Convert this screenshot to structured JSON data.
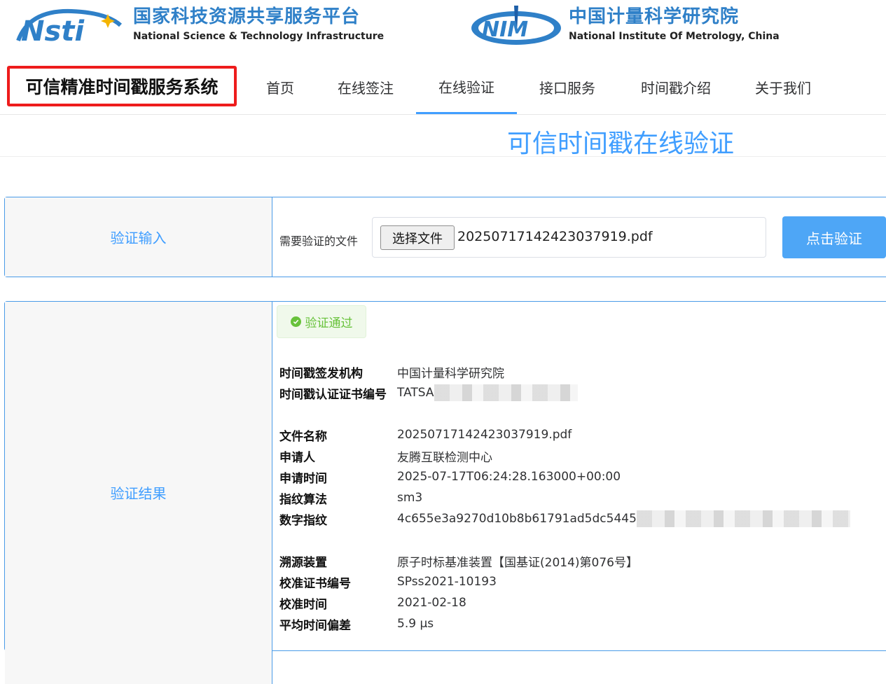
{
  "header": {
    "left_logo": {
      "cn": "国家科技资源共享服务平台",
      "en": "National Science & Technology Infrastructure"
    },
    "right_logo": {
      "cn": "中国计量科学研究院",
      "en": "National Institute Of Metrology, China"
    }
  },
  "nav": {
    "brand": "可信精准时间戳服务系统",
    "items": [
      "首页",
      "在线签注",
      "在线验证",
      "接口服务",
      "时间戳介绍",
      "关于我们"
    ],
    "active": "在线验证"
  },
  "page_title": "可信时间戳在线验证",
  "input_panel": {
    "label": "验证输入",
    "file_label": "需要验证的文件",
    "choose_file_button": "选择文件",
    "file_name": "20250717142423037919.pdf",
    "verify_button": "点击验证"
  },
  "result_panel": {
    "label": "验证结果",
    "status": "验证通过",
    "status_color": "#67c23a",
    "issuer_label": "时间戳签发机构",
    "issuer_value": "中国计量科学研究院",
    "cert_no_label": "时间戳认证证书编号",
    "cert_no_value": "TATSA",
    "file_name_label": "文件名称",
    "file_name_value": "20250717142423037919.pdf",
    "applicant_label": "申请人",
    "applicant_value": "友腾互联检测中心",
    "apply_time_label": "申请时间",
    "apply_time_value": "2025-07-17T06:24:28.163000+00:00",
    "algorithm_label": "指纹算法",
    "algorithm_value": "sm3",
    "digest_label": "数字指纹",
    "digest_value": "4c655e3a9270d10b8b61791ad5dc5445",
    "trace_device_label": "溯源装置",
    "trace_device_value": "原子时标基准装置【国基证(2014)第076号】",
    "calib_cert_label": "校准证书编号",
    "calib_cert_value": "SPss2021-10193",
    "calib_time_label": "校准时间",
    "calib_time_value": "2021-02-18",
    "offset_label": "平均时间偏差",
    "offset_value": "5.9 μs"
  },
  "colors": {
    "accent": "#409eff",
    "brand_border": "#ee1c1c",
    "panel_border": "#4a9be8",
    "success": "#67c23a"
  }
}
